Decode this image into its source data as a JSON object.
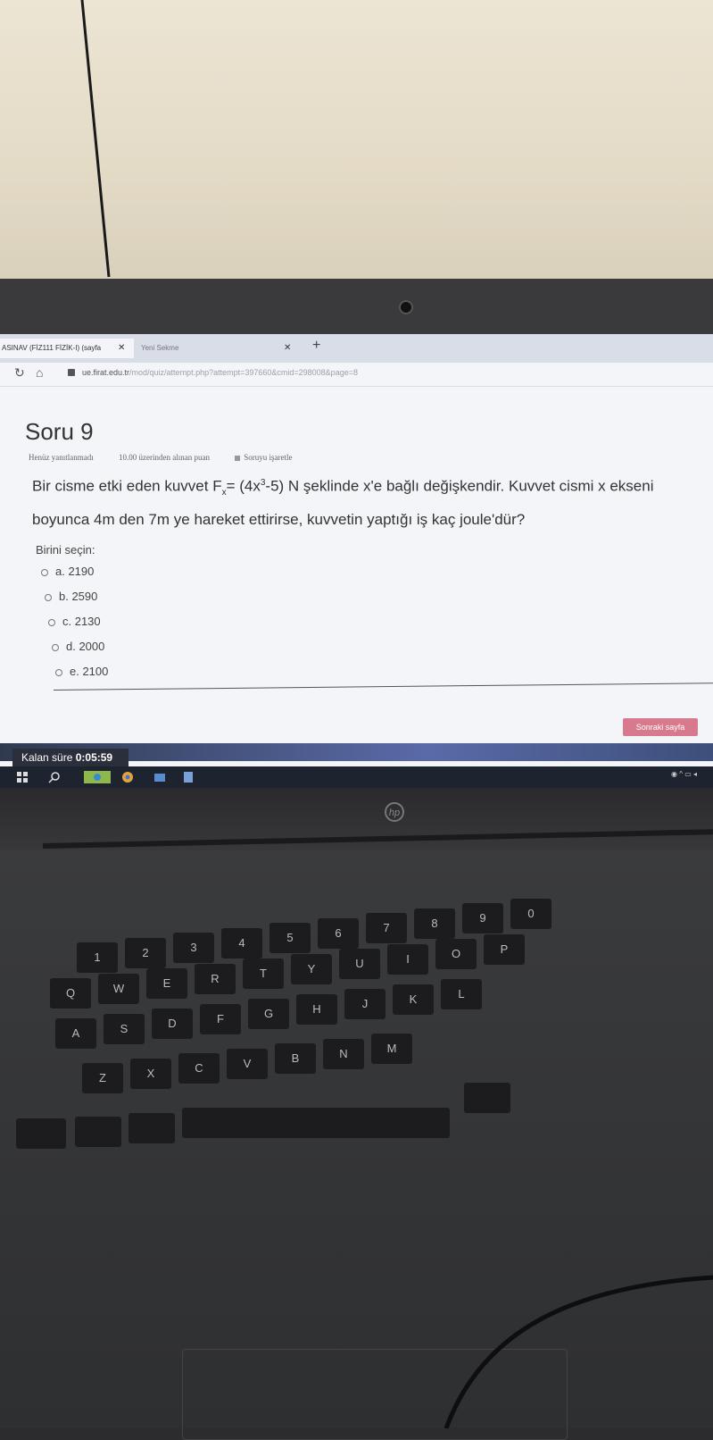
{
  "browser": {
    "tabs": [
      {
        "label": "ASINAV (FİZ111 FİZİK-I) (sayfa",
        "active": true
      },
      {
        "label": "Yeni Sekme",
        "active": false
      }
    ],
    "url_host": "ue.firat.edu.tr",
    "url_path": "/mod/quiz/attempt.php?attempt=397660&cmid=298008&page=8"
  },
  "quiz": {
    "title": "Soru 9",
    "status": "Henüz yanıtlanmadı",
    "points": "10.00 üzerinden alınan puan",
    "flag": "Soruyu işaretle",
    "question_prefix": "Bir cisme etki eden kuvvet F",
    "question_sub": "x",
    "question_mid1": "= (4x",
    "question_sup": "3",
    "question_mid2": "-5) N şeklinde x'e bağlı değişkendir. Kuvvet cismi x ekseni boyunca 4m den 7m ye hareket ettirirse, kuvvetin yaptığı iş kaç joule'dür?",
    "choose_label": "Birini seçin:",
    "options": [
      "a. 2190",
      "b. 2590",
      "c. 2130",
      "d. 2000",
      "e. 2100"
    ],
    "next_button": "Sonraki sayfa",
    "timer_label": "Kalan süre",
    "timer_value": "0:05:59"
  },
  "laptop": {
    "brand": "hp",
    "keys_row1": [
      "1",
      "2",
      "3",
      "4",
      "5",
      "6",
      "7",
      "8",
      "9",
      "0"
    ],
    "keys_row2": [
      "Q",
      "W",
      "E",
      "R",
      "T",
      "Y",
      "U",
      "I",
      "O",
      "P"
    ],
    "keys_row3": [
      "A",
      "S",
      "D",
      "F",
      "G",
      "H",
      "J",
      "K",
      "L"
    ],
    "keys_row4": [
      "Z",
      "X",
      "C",
      "V",
      "B",
      "N",
      "M"
    ]
  },
  "colors": {
    "screen_bg": "#f4f5f8",
    "next_button": "#d87a8e",
    "timer_bar": "#5a6aa8",
    "keyboard_key": "#1c1c1e"
  }
}
